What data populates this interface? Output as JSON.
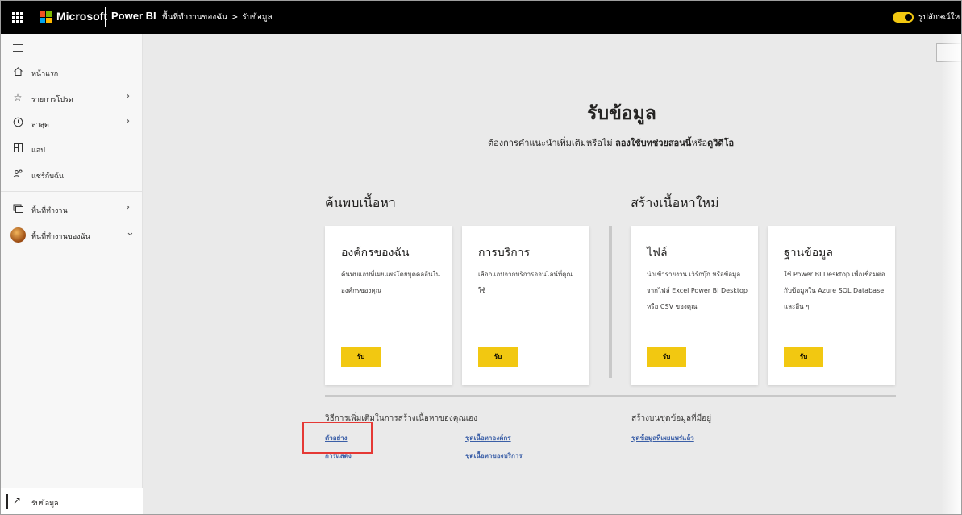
{
  "topbar": {
    "brand": "Microsoft",
    "app_name": "Power BI",
    "breadcrumb": [
      "พื้นที่ทำงานของฉัน",
      "รับข้อมูล"
    ],
    "breadcrumb_separator": ">",
    "toggle_label": "รูปลักษณ์ให",
    "toggle_on": true,
    "brand_colors": [
      "#f25022",
      "#7fba00",
      "#00a4ef",
      "#ffb900"
    ]
  },
  "sidebar": {
    "items": [
      {
        "label": "หน้าแรก",
        "icon": "home-icon",
        "chevron": false
      },
      {
        "label": "รายการโปรด",
        "icon": "star-icon",
        "chevron": true
      },
      {
        "label": "ล่าสุด",
        "icon": "clock-icon",
        "chevron": true
      },
      {
        "label": "แอป",
        "icon": "apps-icon",
        "chevron": false
      },
      {
        "label": "แชร์กับฉัน",
        "icon": "shared-icon",
        "chevron": false
      }
    ],
    "workspace_items": [
      {
        "label": "พื้นที่ทำงาน",
        "icon": "workspaces-icon",
        "chevron": true
      },
      {
        "label": "พื้นที่ทำงานของฉัน",
        "icon": "avatar",
        "chevron": true
      }
    ],
    "get_data_label": "รับข้อมูล"
  },
  "main": {
    "title": "รับข้อมูล",
    "subtitle_prefix": "ต้องการคำแนะนำเพิ่มเติมหรือไม่",
    "subtitle_link1": "ลองใช้บทช่วยสอนนี้",
    "subtitle_mid": "หรือ",
    "subtitle_link2": "ดูวิดีโอ",
    "discover_heading": "ค้นพบเนื้อหา",
    "create_heading": "สร้างเนื้อหาใหม่",
    "cards": [
      {
        "title": "องค์กรของฉัน",
        "desc": "ค้นพบแอปที่เผยแพร่โดยบุคคลอื่นในองค์กรของคุณ",
        "button": "รับ"
      },
      {
        "title": "การบริการ",
        "desc": "เลือกแอปจากบริการออนไลน์ที่คุณใช้",
        "button": "รับ"
      },
      {
        "title": "ไฟล์",
        "desc": "นำเข้ารายงาน เวิร์กบุ๊ก หรือข้อมูลจากไฟล์ Excel Power BI Desktop หรือ CSV ของคุณ",
        "button": "รับ"
      },
      {
        "title": "ฐานข้อมูล",
        "desc": "ใช้ Power BI Desktop เพื่อเชื่อมต่อกับข้อมูลใน Azure SQL Database และอื่น ๆ",
        "button": "รับ"
      }
    ],
    "more_ways_heading": "วิธีการเพิ่มเติมในการสร้างเนื้อหาของคุณเอง",
    "more_links": [
      "ตัวอย่าง",
      "การแสดง",
      "ชุดเนื้อหาองค์กร",
      "ชุดเนื้อหาของบริการ"
    ],
    "existing_heading": "สร้างบนชุดข้อมูลที่มีอยู่",
    "existing_link": "ชุดข้อมูลที่เผยแพร่แล้ว",
    "accent_color": "#f2c811",
    "highlight_color": "#e53935"
  }
}
